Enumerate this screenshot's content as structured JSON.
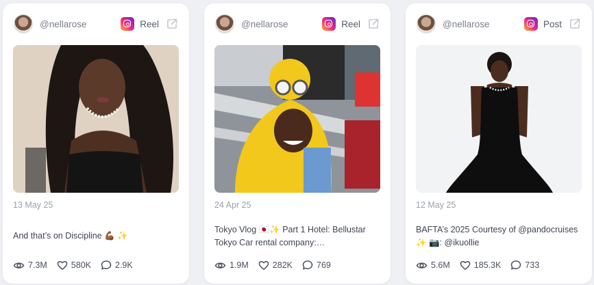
{
  "posts": [
    {
      "handle": "@nellarose",
      "type": "Reel",
      "date": "13 May 25",
      "caption": "And that’s on Discipline 💪🏾 ✨",
      "views": "7.3M",
      "likes": "580K",
      "comments": "2.9K"
    },
    {
      "handle": "@nellarose",
      "type": "Reel",
      "date": "24 Apr 25",
      "caption": "Tokyo Vlog 🇯🇵✨ Part 1 Hotel: Bellustar Tokyo Car rental company:…",
      "views": "1.9M",
      "likes": "282K",
      "comments": "769"
    },
    {
      "handle": "@nellarose",
      "type": "Post",
      "date": "12 May 25",
      "caption": "BAFTA’s 2025 Courtesy of @pandocruises ✨ 📷: @ikuollie",
      "views": "5.6M",
      "likes": "185.3K",
      "comments": "733"
    }
  ],
  "icons": {
    "platform": "instagram-icon",
    "external": "external-link-icon",
    "views": "eye-icon",
    "likes": "heart-icon",
    "comments": "comment-icon"
  },
  "colors": {
    "background": "#eef0f4",
    "card": "#ffffff",
    "muted_text": "#9aa0aa",
    "handle_text": "#7a7f8a"
  }
}
